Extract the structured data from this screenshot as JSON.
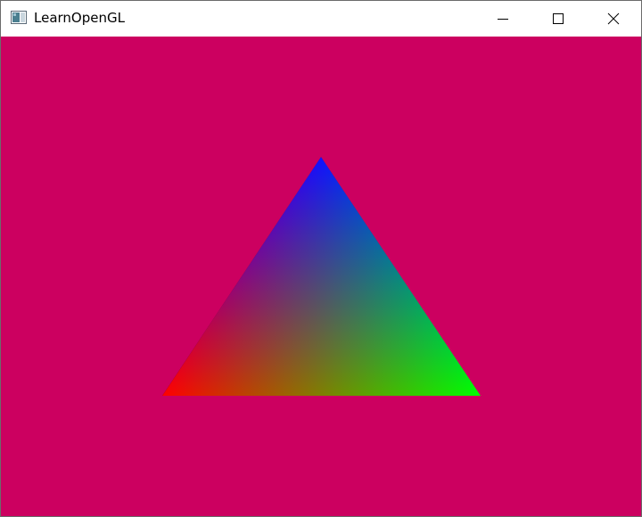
{
  "window": {
    "title": "LearnOpenGL",
    "buttons": {
      "minimize_icon": "minimize-icon",
      "maximize_icon": "maximize-icon",
      "close_icon": "close-icon"
    }
  },
  "viewport": {
    "clear_color": "#cc0060",
    "triangle": {
      "vertices": [
        {
          "name": "bottom-left",
          "color": "#ff0000"
        },
        {
          "name": "bottom-right",
          "color": "#00ff00"
        },
        {
          "name": "top",
          "color": "#0000ff"
        }
      ]
    }
  }
}
